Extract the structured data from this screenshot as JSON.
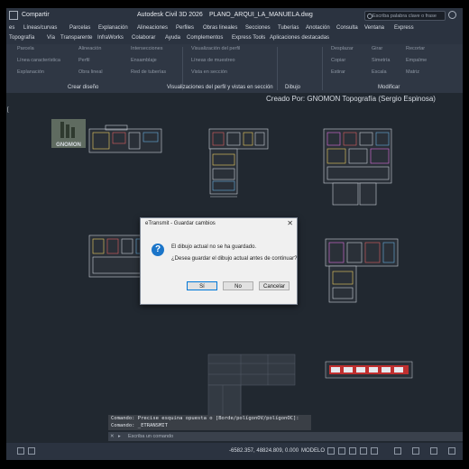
{
  "titlebar": {
    "share_label": "Compartir",
    "app_title": "Autodesk Civil 3D 2026",
    "file_name": "PLANO_ARQUI_LA_MANUELA.dwg",
    "search_placeholder": "Escriba palabra clave o frase"
  },
  "menu": {
    "row1": [
      "es",
      "Líneas/curvas",
      "Parcelas",
      "Explanación",
      "Alineaciones",
      "Perfiles",
      "Obras lineales",
      "Secciones",
      "Tuberías",
      "Anotación",
      "Consulta",
      "Ventana",
      "Express"
    ],
    "row2": [
      "Topografía",
      "Vía",
      "Transparente",
      "InfraWorks",
      "Colaborar",
      "Ayuda",
      "Complementos",
      "Express Tools",
      "Aplicaciones destacadas"
    ]
  },
  "ribbon": {
    "create_design": [
      "Parcela",
      "Línea característica",
      "Explanación",
      "Alineación",
      "Perfil",
      "Obra lineal",
      "Intersecciones",
      "Ensamblaje",
      "Red de tuberías"
    ],
    "profile_views": [
      "Visualización del perfil",
      "Líneas de muestreo",
      "Vista en sección"
    ],
    "modify_tools": [
      "Desplazar",
      "Copiar",
      "Estirar",
      "Girar",
      "Simetría",
      "Escala",
      "Recortar",
      "Empalme",
      "Matriz"
    ],
    "groups": {
      "create_design": "Crear diseño",
      "profile_views": "Visualizaciones del perfil y vistas en sección",
      "draw": "Dibujo",
      "modify": "Modificar"
    }
  },
  "canvas": {
    "credit": "Creado Por: GNOMON Topografía (Sergio Espinosa)",
    "logo_text": "GNOMON",
    "bracket": "["
  },
  "dialog": {
    "title": "eTransmit - Guardar cambios",
    "close": "✕",
    "icon": "?",
    "line1": "El dibujo actual no se ha guardado.",
    "line2": "¿Desea guardar el dibujo actual antes de continuar?",
    "buttons": {
      "yes": "Sí",
      "no": "No",
      "cancel": "Cancelar"
    }
  },
  "command": {
    "history1": "Comando: Precise esquina opuesta o [Borde/polígonOV/polígonOC]:",
    "history2": "Comando: _ETRANSMIT",
    "placeholder": "Escriba un comando"
  },
  "status": {
    "coordinates": "-6582.357, 48824.809, 0.000",
    "mode": "MODELO"
  }
}
